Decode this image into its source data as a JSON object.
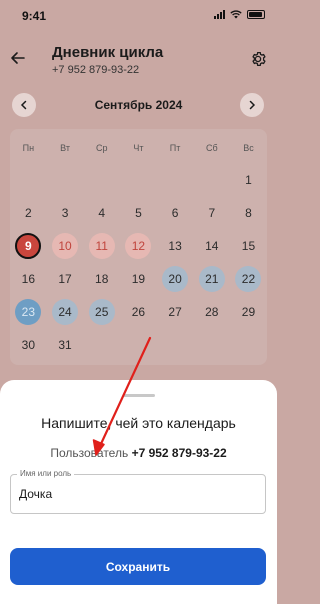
{
  "status_bar": {
    "time": "9:41"
  },
  "header": {
    "title": "Дневник цикла",
    "subtitle": "+7 952 879-93-22"
  },
  "calendar": {
    "month_label": "Сентябрь 2024",
    "weekdays": [
      "Пн",
      "Вт",
      "Ср",
      "Чт",
      "Пт",
      "Сб",
      "Вс"
    ],
    "lead_blank_days": 6,
    "days": [
      {
        "n": "1",
        "state": "normal"
      },
      {
        "n": "2",
        "state": "normal"
      },
      {
        "n": "3",
        "state": "normal"
      },
      {
        "n": "4",
        "state": "normal"
      },
      {
        "n": "5",
        "state": "normal"
      },
      {
        "n": "6",
        "state": "normal"
      },
      {
        "n": "7",
        "state": "normal"
      },
      {
        "n": "8",
        "state": "normal"
      },
      {
        "n": "9",
        "state": "today"
      },
      {
        "n": "10",
        "state": "period"
      },
      {
        "n": "11",
        "state": "period"
      },
      {
        "n": "12",
        "state": "period"
      },
      {
        "n": "13",
        "state": "normal"
      },
      {
        "n": "14",
        "state": "normal"
      },
      {
        "n": "15",
        "state": "normal"
      },
      {
        "n": "16",
        "state": "normal"
      },
      {
        "n": "17",
        "state": "normal"
      },
      {
        "n": "18",
        "state": "normal"
      },
      {
        "n": "19",
        "state": "normal"
      },
      {
        "n": "20",
        "state": "fertile"
      },
      {
        "n": "21",
        "state": "fertile"
      },
      {
        "n": "22",
        "state": "fertile"
      },
      {
        "n": "23",
        "state": "ovulation"
      },
      {
        "n": "24",
        "state": "fertile"
      },
      {
        "n": "25",
        "state": "fertile"
      },
      {
        "n": "26",
        "state": "normal"
      },
      {
        "n": "27",
        "state": "normal"
      },
      {
        "n": "28",
        "state": "normal"
      },
      {
        "n": "29",
        "state": "normal"
      },
      {
        "n": "30",
        "state": "normal"
      },
      {
        "n": "31",
        "state": "normal"
      }
    ]
  },
  "sheet": {
    "title": "Напишите, чей это календарь",
    "user_prefix": "Пользователь",
    "user_phone": "+7 952 879-93-22",
    "field_label": "Имя или роль",
    "field_value": "Дочка",
    "save_label": "Сохранить"
  },
  "colors": {
    "accent": "#1f5fcf",
    "period": "#c9463d",
    "fertile": "#a9b9c9",
    "ovulation": "#6e9ec4",
    "annotation_arrow": "#e0201b"
  },
  "icons": [
    "back-arrow-icon",
    "gear-icon",
    "chevron-left-icon",
    "chevron-right-icon",
    "signal-icon",
    "wifi-icon",
    "battery-icon"
  ]
}
